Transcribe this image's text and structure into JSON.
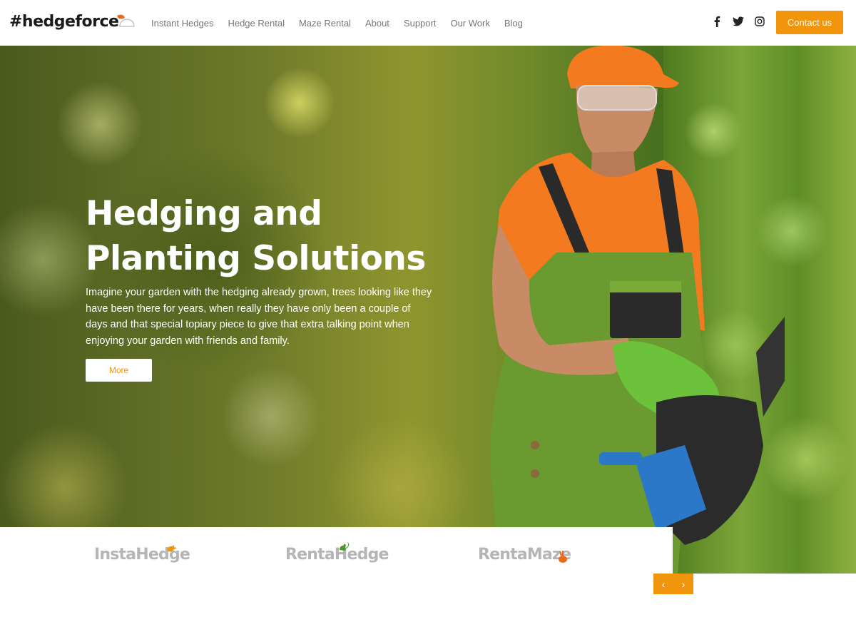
{
  "header": {
    "logo_text": "#hedgeforce",
    "home_icon": "home-outline-icon",
    "nav": [
      "Instant Hedges",
      "Hedge Rental",
      "Maze Rental",
      "About",
      "Support",
      "Our Work",
      "Blog"
    ],
    "social_icons": [
      "facebook-icon",
      "twitter-icon",
      "instagram-icon"
    ],
    "contact_label": "Contact us"
  },
  "hero": {
    "title_line1": "Hedging and",
    "title_line2": "Planting Solutions",
    "body": "Imagine your garden with the hedging already grown, trees looking like they have been there for years, when really they have only been a couple of days and that special topiary piece to give that extra talking point when enjoying your garden with friends and family.",
    "button_label": "More"
  },
  "brands": [
    {
      "name": "InstaHedge",
      "mark": "bird-icon",
      "mark_color": "#f0950c"
    },
    {
      "name": "RentaHedge",
      "mark": "squirrel-icon",
      "mark_color": "#4a9a2a"
    },
    {
      "name": "RentaMaze",
      "mark": "rabbit-icon",
      "mark_color": "#e86a1c"
    }
  ],
  "slider": {
    "prev": "‹",
    "next": "›"
  },
  "colors": {
    "accent": "#f0950c",
    "nav_text": "#777777",
    "brand_grey": "#b5b5b5"
  }
}
